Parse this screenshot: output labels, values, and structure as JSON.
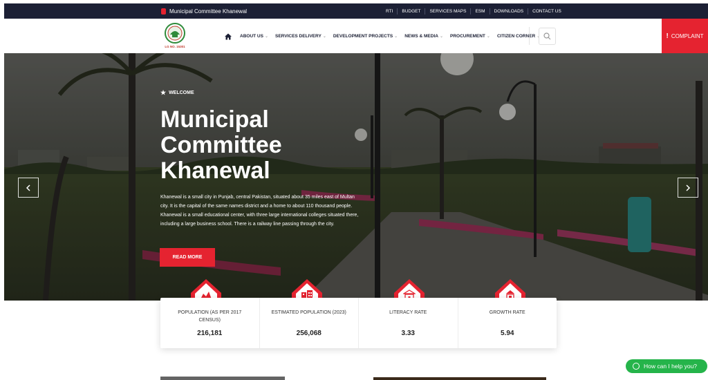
{
  "topbar": {
    "site_name": "Municipal Committee Khanewal",
    "links": [
      "RTI",
      "BUDGET",
      "SERVICES MAPS",
      "ESM",
      "DOWNLOADS",
      "CONTACT US"
    ]
  },
  "nav": {
    "logo_text": "LG NO. 15301",
    "menu": [
      {
        "label": "ABOUT US"
      },
      {
        "label": "SERVICES DELIVERY"
      },
      {
        "label": "DEVELOPMENT PROJECTS"
      },
      {
        "label": "NEWS & MEDIA"
      },
      {
        "label": "PROCUREMENT"
      },
      {
        "label": "CITIZEN CORNER"
      }
    ],
    "complaint_label": "COMPLAINT",
    "icons": [
      "home-icon",
      "search-icon",
      "exclamation-icon"
    ]
  },
  "hero": {
    "eyebrow": "WELCOME",
    "title": "Municipal Committee Khanewal",
    "description": "Khanewal is a small city in Punjab, central Pakistan, situated about 35 miles east of Multan city. It is the capital of the same names district and a home to about 110 thousand people. Khanewal is a small educational center, with three large international colleges situated there, including a large business school. There is a railway line passing through the city.",
    "button_label": "READ MORE"
  },
  "stats": [
    {
      "label": "POPULATION (AS PER 2017 CENSUS)",
      "value": "216,181",
      "icon": "chart-icon"
    },
    {
      "label": "ESTIMATED POPULATION (2023)",
      "value": "256,068",
      "icon": "buildings-icon"
    },
    {
      "label": "LITERACY RATE",
      "value": "3.33",
      "icon": "school-icon"
    },
    {
      "label": "GROWTH RATE",
      "value": "5.94",
      "icon": "growth-icon"
    }
  ],
  "help_button": "How can I help you?",
  "colors": {
    "brand_red": "#e52330",
    "dark_navy": "#1c2035",
    "whatsapp_green": "#25b44a"
  }
}
